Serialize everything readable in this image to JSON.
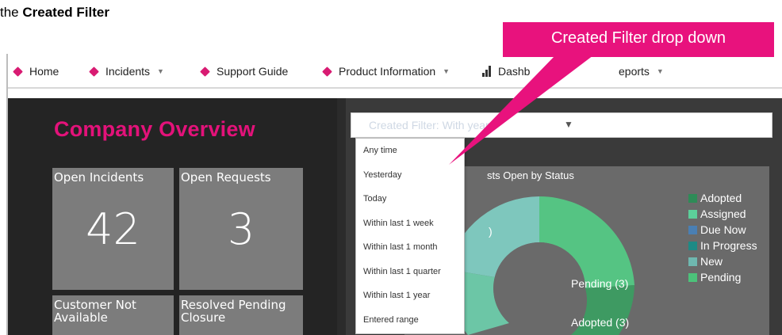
{
  "doc": {
    "prefix": "the ",
    "bold": "Created Filter"
  },
  "nav": {
    "items": [
      {
        "label": "Home"
      },
      {
        "label": "Incidents"
      },
      {
        "label": "Support Guide"
      },
      {
        "label": "Product Information"
      },
      {
        "label": "Dashb"
      },
      {
        "label": "eports"
      }
    ]
  },
  "dashboard": {
    "title": "Company Overview",
    "tiles": [
      {
        "label": "Open Incidents",
        "value": "42"
      },
      {
        "label": "Open Requests",
        "value": "3"
      },
      {
        "label": "Customer Not Available",
        "value": ""
      },
      {
        "label": "Resolved Pending Closure",
        "value": ""
      }
    ]
  },
  "filter": {
    "text": "Created Filter: With            year",
    "caret": "▼",
    "options": [
      "Any time",
      "Yesterday",
      "Today",
      "Within last 1 week",
      "Within last 1 month",
      "Within last 1 quarter",
      "Within last 1 year",
      "Entered range"
    ]
  },
  "chart": {
    "title": "sts Open by Status",
    "label_partial": ")",
    "label_pending": "Pending (3)",
    "label_adopted": "Adopted (3)"
  },
  "chart_data": {
    "type": "pie",
    "title": "sts Open by Status",
    "legend_position": "right",
    "categories": [
      "Adopted",
      "Assigned",
      "Due Now",
      "In Progress",
      "New",
      "Pending"
    ],
    "colors": [
      "#2e8b57",
      "#5ccf9a",
      "#4a7fb3",
      "#1d8a85",
      "#6fb8b0",
      "#4cc27a"
    ],
    "visible_slice_labels": [
      {
        "name": "Pending",
        "value": 3
      },
      {
        "name": "Adopted",
        "value": 3
      }
    ]
  },
  "callout": {
    "text": "Created Filter drop down"
  },
  "colors": {
    "accent": "#e8127d",
    "title": "#e3127a",
    "tile": "#7c7c7c",
    "panel": "#242424"
  }
}
